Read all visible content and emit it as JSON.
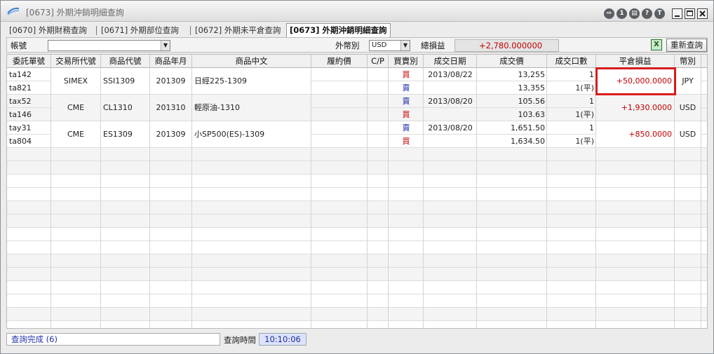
{
  "window": {
    "title": "[0673] 外期沖銷明細查詢"
  },
  "titlebar_buttons": [
    {
      "icon": "export-icon",
      "glyph": "⇨"
    },
    {
      "icon": "info-icon",
      "glyph": "1"
    },
    {
      "icon": "print-icon",
      "glyph": "▤"
    },
    {
      "icon": "help-icon",
      "glyph": "?"
    },
    {
      "icon": "t-icon",
      "glyph": "T"
    }
  ],
  "tabs": [
    {
      "label": "[0670] 外期財務查詢",
      "active": false
    },
    {
      "label": "[0671] 外期部位查詢",
      "active": false
    },
    {
      "label": "[0672] 外期未平倉查詢",
      "active": false
    },
    {
      "label": "[0673] 外期沖銷明細查詢",
      "active": true
    }
  ],
  "filter": {
    "account_label": "帳號",
    "account_value": "",
    "currency_label": "外幣別",
    "currency_value": "USD",
    "total_pl_label": "總損益",
    "total_pl_value": "+2,780.000000",
    "requery_label": "重新查詢",
    "excel_icon": "X"
  },
  "columns": [
    "委託單號",
    "交易所代號",
    "商品代號",
    "商品年月",
    "商品中文",
    "履約價",
    "C/P",
    "買賣別",
    "成交日期",
    "成交價",
    "成交口數",
    "平倉損益",
    "幣別"
  ],
  "rows": [
    {
      "order": "ta142",
      "exch": "SIMEX",
      "code": "SSI1309",
      "ym": "201309",
      "name": "日經225-1309",
      "strike": "",
      "cp": "",
      "side": "買",
      "side_color": "red",
      "date": "2013/08/22",
      "price": "13,255",
      "qty": "1",
      "pl": "+50,000.0000",
      "cur": "JPY",
      "group_first": true
    },
    {
      "order": "ta821",
      "exch": "",
      "code": "",
      "ym": "",
      "name": "",
      "strike": "",
      "cp": "",
      "side": "賣",
      "side_color": "blue",
      "date": "",
      "price": "13,355",
      "qty": "1(平)",
      "pl": "",
      "cur": "",
      "group_first": false
    },
    {
      "order": "tax52",
      "exch": "CME",
      "code": "CL1310",
      "ym": "201310",
      "name": "輕原油-1310",
      "strike": "",
      "cp": "",
      "side": "賣",
      "side_color": "blue",
      "date": "2013/08/20",
      "price": "105.56",
      "qty": "1",
      "pl": "+1,930.0000",
      "cur": "USD",
      "group_first": true
    },
    {
      "order": "ta146",
      "exch": "",
      "code": "",
      "ym": "",
      "name": "",
      "strike": "",
      "cp": "",
      "side": "買",
      "side_color": "red",
      "date": "",
      "price": "103.63",
      "qty": "1(平)",
      "pl": "",
      "cur": "",
      "group_first": false
    },
    {
      "order": "tay31",
      "exch": "CME",
      "code": "ES1309",
      "ym": "201309",
      "name": "小SP500(ES)-1309",
      "strike": "",
      "cp": "",
      "side": "賣",
      "side_color": "blue",
      "date": "2013/08/20",
      "price": "1,651.50",
      "qty": "1",
      "pl": "+850.0000",
      "cur": "USD",
      "group_first": true
    },
    {
      "order": "ta804",
      "exch": "",
      "code": "",
      "ym": "",
      "name": "",
      "strike": "",
      "cp": "",
      "side": "買",
      "side_color": "red",
      "date": "",
      "price": "1,634.50",
      "qty": "1(平)",
      "pl": "",
      "cur": "",
      "group_first": false
    }
  ],
  "status": {
    "message": "查詢完成 (6)",
    "time_label": "查詢時間",
    "time_value": "10:10:06"
  }
}
